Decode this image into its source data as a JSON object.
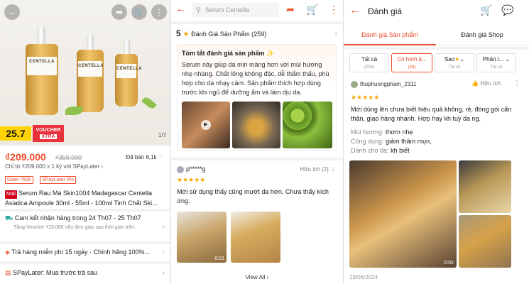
{
  "p1": {
    "hero": {
      "counter": "1/7",
      "badge": "25.7",
      "voucher_top": "VOUCHER",
      "voucher_bottom": "XTRA",
      "brand_label": "CENTELLA"
    },
    "price": "₫209.000",
    "old_price": "₫350.000",
    "sold": "Đã bán 6,1k",
    "installment": "Chỉ từ ₫209.000 x 1 kỳ với SPayLater",
    "tags": [
      "Giảm ₫50k",
      "SPayLater 0%"
    ],
    "mall_tag": "Mall",
    "title": "Serum Rau Má Skin1004 Madagascar Centella Asiatica Ampoule 30ml - 55ml - 100ml Tinh Chất Ski...",
    "delivery": {
      "title": "Cam kết nhận hàng trong 24 Th07 - 25 Th07",
      "sub": "Tặng Voucher ₫15.000 nếu đơn giao sau thời gian trên."
    },
    "returns": "Trả hàng miễn phí 15 ngày · Chính hãng 100%...",
    "spay": "SPayLater: Mua trước trả sau"
  },
  "p2": {
    "search_placeholder": "Serum Centella",
    "rating_value": "5",
    "rating_label": "Đánh Giá Sản Phẩm (259)",
    "summary_title": "Tóm tắt đánh giá sản phẩm",
    "summary_text": "Serum này giúp da mịn màng hơn với mùi hương nhẹ nhàng. Chất lỏng không đặc, dễ thẩm thấu, phù hợp cho da nhạy cảm. Sản phẩm thích hợp dùng trước khi ngủ để dưỡng ẩm và làm dịu da.",
    "review": {
      "user": "p*****g",
      "helpful": "Hữu ích (2)",
      "text": "Mới sử dụng thấy cũng mướt da hơn. Chưa thấy kích ứng.",
      "video_time": "0:01"
    },
    "view_all": "View All"
  },
  "p3": {
    "title": "Đánh giá",
    "tabs": [
      "Đánh giá Sản phẩm",
      "Đánh giá Shop"
    ],
    "chips": [
      {
        "label": "Tất cả",
        "sub": "(259)"
      },
      {
        "label": "Có hình ả...",
        "sub": "(33)"
      },
      {
        "label": "Sao",
        "sub": "Tất cả"
      },
      {
        "label": "Phân l...",
        "sub": "Tất cả"
      }
    ],
    "review": {
      "user": "thuphuongpham_2311",
      "helpful": "Hữu ích",
      "text": "Mới dùng lên chưa biết hiệu quả không, rẻ, đóng gói cẩn thận, giao hàng nhanh. Hợp hay kh tuỳ da ng.",
      "scent_label": "Mùi hương:",
      "scent": "thơm nhẹ",
      "use_label": "Công dụng:",
      "use": "giảm thâm mụn,",
      "skin_label": "Dành cho da:",
      "skin": "kh biết",
      "video_time": "0:02",
      "date": "19/06/2024"
    }
  },
  "colors": {
    "accent": "#ee4d2d",
    "star": "#f6a700",
    "mall": "#d0011b"
  }
}
